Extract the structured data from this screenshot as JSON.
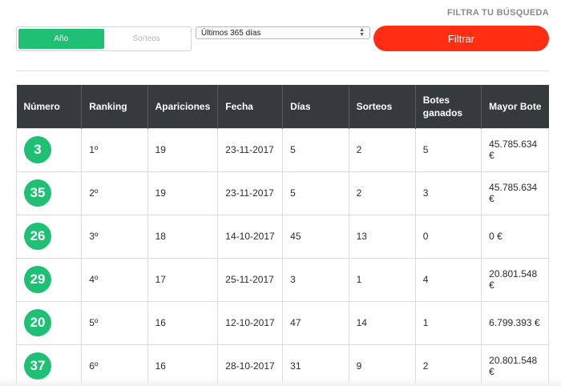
{
  "filter_heading": "FILTRA TU BÚSQUEDA",
  "toggle": {
    "options": [
      "Año",
      "Sorteos"
    ],
    "active": "Año"
  },
  "period_select": {
    "value": "Últimos 365 días"
  },
  "filter_button": "Filtrar",
  "colors": {
    "accent_green": "#1fbf74",
    "filter_red": "#ff2d12",
    "header_dark": "#353a3d"
  },
  "table": {
    "headers": [
      "Número",
      "Ranking",
      "Apariciones",
      "Fecha",
      "Días",
      "Sorteos",
      "Botes ganados",
      "Mayor Bote"
    ],
    "rows": [
      [
        "3",
        "1º",
        "19",
        "23-11-2017",
        "5",
        "2",
        "5",
        "45.785.634 €"
      ],
      [
        "35",
        "2º",
        "19",
        "23-11-2017",
        "5",
        "2",
        "3",
        "45.785.634 €"
      ],
      [
        "26",
        "3º",
        "18",
        "14-10-2017",
        "45",
        "13",
        "0",
        "0 €"
      ],
      [
        "29",
        "4º",
        "17",
        "25-11-2017",
        "3",
        "1",
        "4",
        "20.801.548 €"
      ],
      [
        "20",
        "5º",
        "16",
        "12-10-2017",
        "47",
        "14",
        "1",
        "6.799.393 €"
      ],
      [
        "37",
        "6º",
        "16",
        "28-10-2017",
        "31",
        "9",
        "2",
        "20.801.548 €"
      ]
    ]
  }
}
